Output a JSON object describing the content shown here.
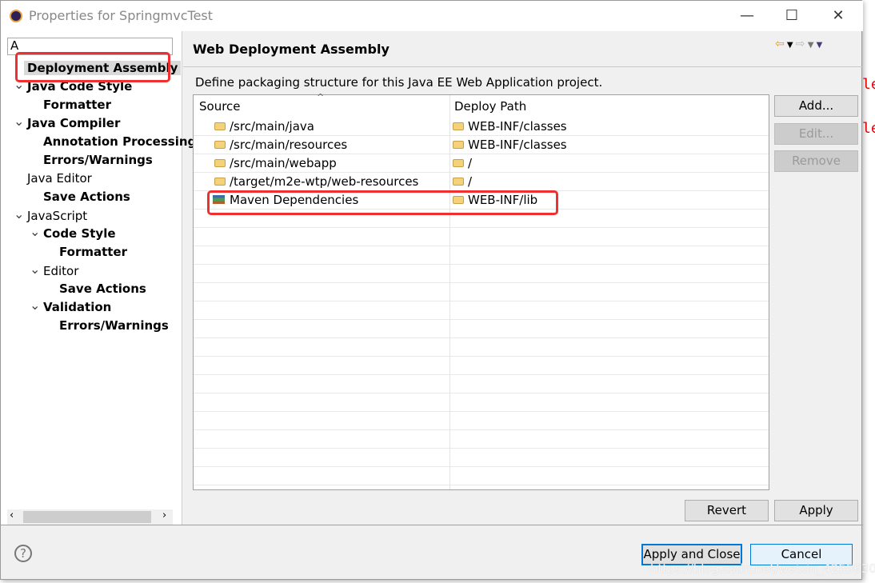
{
  "window": {
    "title": "Properties for SpringmvcTest",
    "minimize": "—",
    "maximize": "☐",
    "close": "✕"
  },
  "filter": {
    "value": "A"
  },
  "tree": [
    {
      "label": "Deployment Assembly",
      "bold": true,
      "selected": true
    },
    {
      "label": "Java Code Style",
      "bold": true,
      "expanded": true
    },
    {
      "label": "Formatter",
      "bold": true
    },
    {
      "label": "Java Compiler",
      "bold": true,
      "expanded": true
    },
    {
      "label": "Annotation Processing",
      "bold": true
    },
    {
      "label": "Errors/Warnings",
      "bold": true
    },
    {
      "label": "Java Editor",
      "bold": false
    },
    {
      "label": "Save Actions",
      "bold": true
    },
    {
      "label": "JavaScript",
      "bold": false,
      "expanded": true
    },
    {
      "label": "Code Style",
      "bold": true,
      "expanded": true
    },
    {
      "label": "Formatter",
      "bold": true
    },
    {
      "label": "Editor",
      "bold": false,
      "expanded": true
    },
    {
      "label": "Save Actions",
      "bold": true
    },
    {
      "label": "Validation",
      "bold": true,
      "expanded": true
    },
    {
      "label": "Errors/Warnings",
      "bold": true
    }
  ],
  "page": {
    "title": "Web Deployment Assembly",
    "description": "Define packaging structure for this Java EE Web Application project."
  },
  "table": {
    "columns": [
      "Source",
      "Deploy Path"
    ],
    "rows": [
      {
        "source": "/src/main/java",
        "deploy": "WEB-INF/classes",
        "icon": "folder-icon"
      },
      {
        "source": "/src/main/resources",
        "deploy": "WEB-INF/classes",
        "icon": "folder-icon"
      },
      {
        "source": "/src/main/webapp",
        "deploy": "/",
        "icon": "folder-icon"
      },
      {
        "source": "/target/m2e-wtp/web-resources",
        "deploy": "/",
        "icon": "folder-icon"
      },
      {
        "source": "Maven Dependencies",
        "deploy": "WEB-INF/lib",
        "icon": "library-icon"
      }
    ]
  },
  "buttons": {
    "add": "Add...",
    "edit": "Edit...",
    "remove": "Remove",
    "revert": "Revert",
    "apply": "Apply",
    "apply_close": "Apply and Close",
    "cancel": "Cancel"
  },
  "watermark": "https://blog.csdn.net/weixin_42556307",
  "colors": {
    "highlight": "#f03030",
    "accent": "#0078d7"
  }
}
